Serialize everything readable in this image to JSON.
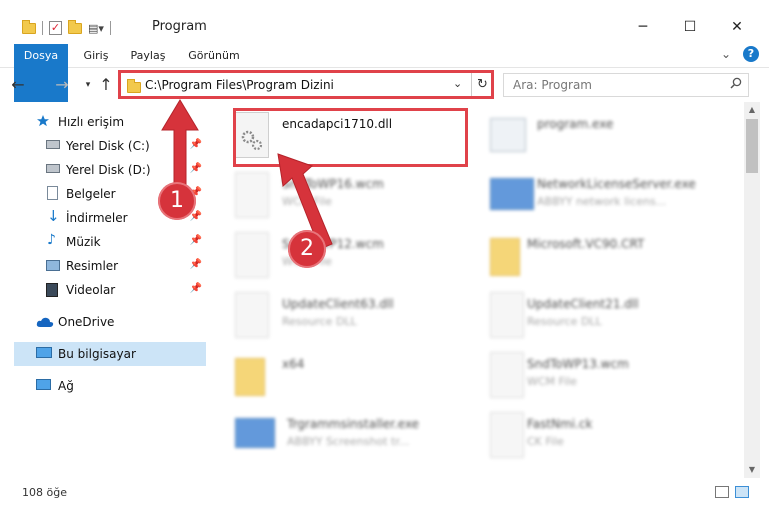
{
  "window": {
    "title": "Program"
  },
  "ribbon": {
    "tabs": [
      "Dosya",
      "Giriş",
      "Paylaş",
      "Görünüm"
    ]
  },
  "address": {
    "path": "C:\\Program Files\\Program Dizini"
  },
  "search": {
    "placeholder": "Ara: Program"
  },
  "sidebar": {
    "items": [
      {
        "label": "Hızlı erişim",
        "icon": "star-icon"
      },
      {
        "label": "Yerel Disk (C:)",
        "icon": "drive-icon",
        "pinned": true
      },
      {
        "label": "Yerel Disk (D:)",
        "icon": "drive-icon",
        "pinned": true
      },
      {
        "label": "Belgeler",
        "icon": "documents-icon",
        "pinned": true
      },
      {
        "label": "İndirmeler",
        "icon": "download-icon",
        "pinned": true
      },
      {
        "label": "Müzik",
        "icon": "music-icon",
        "pinned": true
      },
      {
        "label": "Resimler",
        "icon": "pictures-icon",
        "pinned": true
      },
      {
        "label": "Videolar",
        "icon": "videos-icon",
        "pinned": true
      },
      {
        "label": "OneDrive",
        "icon": "cloud-icon"
      },
      {
        "label": "Bu bilgisayar",
        "icon": "computer-icon",
        "selected": true
      },
      {
        "label": "Ağ",
        "icon": "network-icon"
      }
    ]
  },
  "files": [
    {
      "name": "encadapci1710.dll",
      "type": "",
      "icon": "dll-gear-icon"
    },
    {
      "name": "program.exe",
      "type": "",
      "icon": "exe-icon"
    },
    {
      "name": "SndToWP16.wcm",
      "type": "WCM File",
      "icon": "file-icon"
    },
    {
      "name": "NetworkLicenseServer.exe",
      "type": "ABBYY network licens...",
      "icon": "app-icon"
    },
    {
      "name": "SndToWP12.wcm",
      "type": "WCM File",
      "icon": "file-icon"
    },
    {
      "name": "Microsoft.VC90.CRT",
      "type": "",
      "icon": "folder-icon"
    },
    {
      "name": "UpdateClient63.dll",
      "type": "Resource DLL",
      "icon": "dll-gear-icon"
    },
    {
      "name": "UpdateClient21.dll",
      "type": "Resource DLL",
      "icon": "dll-gear-icon"
    },
    {
      "name": "x64",
      "type": "",
      "icon": "folder-icon"
    },
    {
      "name": "SndToWP13.wcm",
      "type": "WCM File",
      "icon": "file-icon"
    },
    {
      "name": "Trgrammsinstaller.exe",
      "type": "ABBYY Screenshot tr...",
      "icon": "app-icon"
    },
    {
      "name": "FastNmi.ck",
      "type": "CK File",
      "icon": "file-icon"
    }
  ],
  "annotations": {
    "badge1": "1",
    "badge2": "2"
  },
  "status": {
    "count": "108 öğe"
  },
  "colors": {
    "accent": "#1979ca",
    "highlight": "#e0424a",
    "selected": "#cce4f7"
  }
}
